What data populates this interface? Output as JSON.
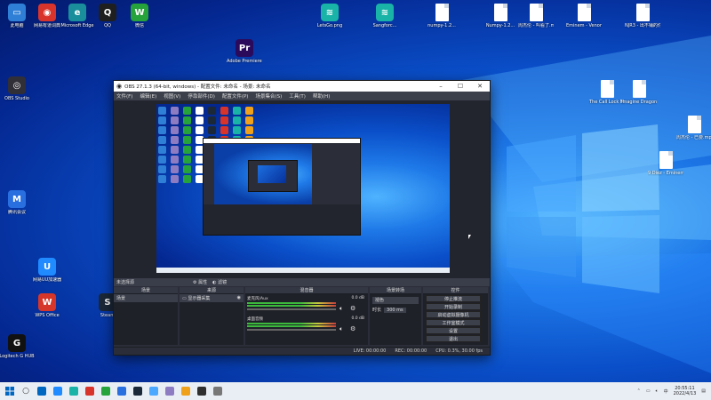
{
  "desktop": {
    "icons": [
      {
        "label": "此电脑",
        "glyph": "▭",
        "color": "#2f7fd6"
      },
      {
        "label": "网易有道词典",
        "glyph": "◉",
        "color": "#d9342b"
      },
      {
        "label": "Microsoft Edge",
        "glyph": "e",
        "color": "#1a8f9b"
      },
      {
        "label": "QQ",
        "glyph": "Q",
        "color": "#1f1f1f"
      },
      {
        "label": "微信",
        "glyph": "W",
        "color": "#27a33b"
      },
      {
        "label": "腾讯会议",
        "glyph": "M",
        "color": "#2a6fe0"
      },
      {
        "label": "Steam",
        "glyph": "S",
        "color": "#1b2838"
      },
      {
        "label": "网易UU加速器",
        "glyph": "U",
        "color": "#1f8bff"
      },
      {
        "label": "OBS Studio",
        "glyph": "◎",
        "color": "#302e36"
      },
      {
        "label": "Logitech G HUB",
        "glyph": "G",
        "color": "#111"
      },
      {
        "label": "LetsGo.png",
        "glyph": "≋",
        "color": "#19b3a7"
      },
      {
        "label": "Sangforc...",
        "glyph": "≋",
        "color": "#19b3a7"
      },
      {
        "label": "numpy-1.2...",
        "glyph": "",
        "color": "#fff"
      },
      {
        "label": "Numpy-1.2...",
        "glyph": "",
        "color": "#fff"
      },
      {
        "label": "Eminem - Venom (M...",
        "glyph": "",
        "color": "#fff"
      },
      {
        "label": "NJR3 - 出不铺的你.mp3",
        "glyph": "",
        "color": "#fff"
      },
      {
        "label": "9.Diemento...",
        "glyph": "",
        "color": "#fff"
      },
      {
        "label": "周杰伦 - 叫看了.mp3",
        "glyph": "",
        "color": "#fff"
      },
      {
        "label": "The Call Lock M...",
        "glyph": "",
        "color": "#fff"
      },
      {
        "label": "Imagine Dragons...",
        "glyph": "",
        "color": "#fff"
      },
      {
        "label": "周杰伦 - 已要.mp3",
        "glyph": "",
        "color": "#fff"
      },
      {
        "label": "9 Diez - Eminem C...",
        "glyph": "",
        "color": "#fff"
      },
      {
        "label": "Adobe Premiere...",
        "glyph": "Pr",
        "color": "#2b0a5c"
      },
      {
        "label": "WPS Office",
        "glyph": "W",
        "color": "#d6362a"
      }
    ]
  },
  "obs": {
    "title": "OBS 27.1.3 (64-bit, windows) - 配置文件: 未命名 - 场景: 未命名",
    "menu": [
      "文件(F)",
      "编辑(E)",
      "视图(V)",
      "停靠部件(D)",
      "配置文件(P)",
      "场景集合(S)",
      "工具(T)",
      "帮助(H)"
    ],
    "no_source": "未选择源",
    "properties": "属性",
    "filters": "滤镜",
    "docks": {
      "scenes": {
        "title": "场景",
        "items": [
          "场景"
        ]
      },
      "sources": {
        "title": "来源",
        "items": [
          "显示器采集"
        ]
      },
      "mixer": {
        "title": "混音器",
        "tracks": [
          {
            "name": "麦克风/Aux",
            "db": "0.0 dB"
          },
          {
            "name": "桌面音频",
            "db": "0.0 dB"
          }
        ]
      },
      "transitions": {
        "title": "场景转场",
        "type": "褪色",
        "duration_label": "时长",
        "duration": "300 ms"
      },
      "controls": {
        "title": "控件",
        "buttons": [
          "停止推流",
          "开始录制",
          "启动虚拟摄像机",
          "工作室模式",
          "设置",
          "退出"
        ]
      }
    },
    "status": {
      "live": "LIVE: 00:00:00",
      "rec": "REC: 00:00:00",
      "cpu": "CPU: 0.3%, 30.00 fps"
    }
  },
  "taskbar": {
    "time": "20:55:11",
    "date": "2022/4/13",
    "lang": "中",
    "colors": [
      "#0067c0",
      "#1f8bff",
      "#19b3a7",
      "#d9342b",
      "#27a33b",
      "#2a6fe0",
      "#1b2838",
      "#4aa8ff",
      "#8e7cc3",
      "#f0a11b",
      "#2f2f2f",
      "#777"
    ]
  }
}
